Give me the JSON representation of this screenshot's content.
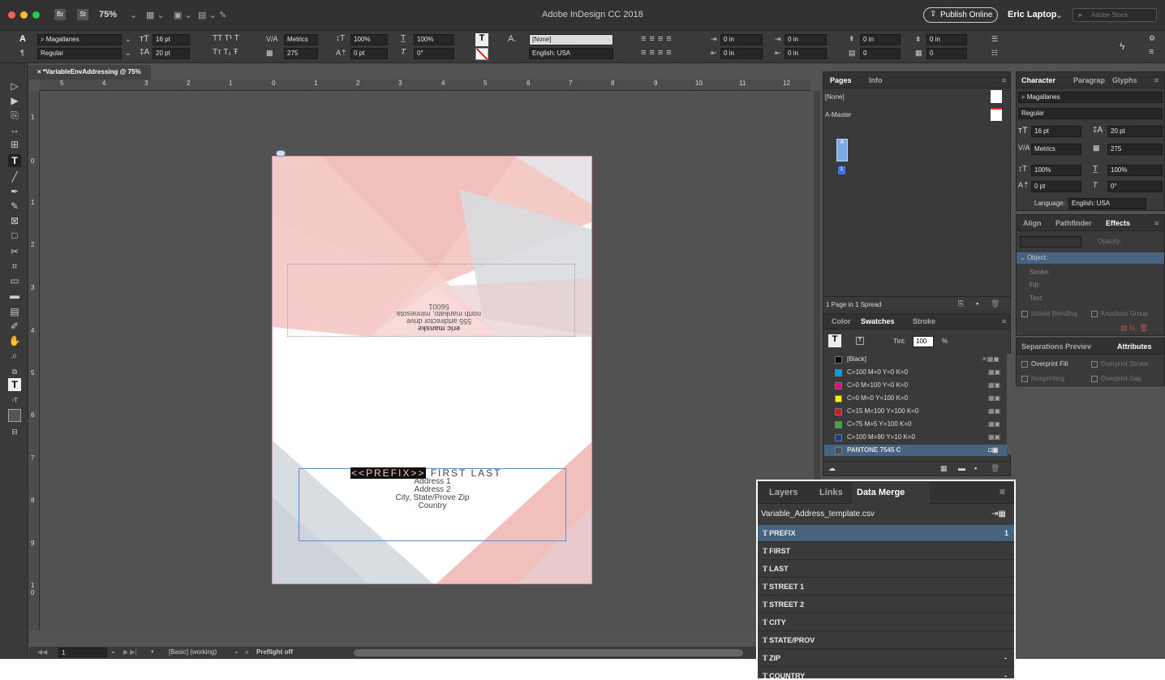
{
  "app": {
    "title": "Adobe InDesign CC 2018",
    "zoom": "75%",
    "br": "Br",
    "st": "St",
    "publish": "Publish Online",
    "user": "Eric Laptop",
    "stock_placeholder": "Adobe Stock"
  },
  "control": {
    "font": "Magallanes",
    "style": "Regular",
    "size": "16 pt",
    "leading": "20 pt",
    "kerning": "Metrics",
    "tracking": "275",
    "vscale": "100%",
    "hscale": "100%",
    "baseline": "0 pt",
    "skew": "0°",
    "char_style": "[None]",
    "language": "English: USA",
    "indent": "0 in",
    "space": "0"
  },
  "document": {
    "tab": "*VariableEnvAddressing @ 75%",
    "ruler_ticks": [
      "5",
      "4",
      "3",
      "2",
      "1",
      "0",
      "1",
      "2",
      "3",
      "4",
      "5",
      "6",
      "7",
      "8",
      "9",
      "10",
      "11",
      "12"
    ],
    "vruler_ticks": [
      "1",
      "0",
      "1",
      "2",
      "3",
      "4",
      "5",
      "6",
      "7",
      "8",
      "9",
      "1 0"
    ]
  },
  "envelope": {
    "return": [
      "eric manske",
      "555 artdirector drive",
      "north mankato, minnesota",
      "56001"
    ],
    "prefix": "<<PREFIX>>",
    "name": "FIRST LAST",
    "address": [
      "Address 1",
      "Address 2",
      "City, State/Prove Zip",
      "Country"
    ]
  },
  "status": {
    "page": "1",
    "master": "[Basic] (working)",
    "preflight": "Preflight off"
  },
  "pages_panel": {
    "tabs": [
      "Pages",
      "Info"
    ],
    "none": "[None]",
    "master": "A-Master",
    "page_num": "1",
    "a": "A",
    "footer": "1 Page in 1 Spread"
  },
  "swatch_panel": {
    "tabs": [
      "Color",
      "Swatches",
      "Stroke"
    ],
    "tint_label": "Tint:",
    "tint": "100",
    "pct": "%",
    "t": "T",
    "swatches": [
      {
        "name": "[Black]",
        "color": "#000000"
      },
      {
        "name": "C=100 M=0 Y=0 K=0",
        "color": "#00a0e9"
      },
      {
        "name": "C=0 M=100 Y=0 K=0",
        "color": "#e4007f"
      },
      {
        "name": "C=0 M=0 Y=100 K=0",
        "color": "#fff100"
      },
      {
        "name": "C=15 M=100 Y=100 K=0",
        "color": "#d21a1f"
      },
      {
        "name": "C=75 M=5 Y=100 K=0",
        "color": "#3ea83b"
      },
      {
        "name": "C=100 M=90 Y=10 K=0",
        "color": "#1f3d90"
      },
      {
        "name": "PANTONE 7545 C",
        "color": "#424f5c"
      }
    ]
  },
  "char_panel": {
    "tabs": [
      "Character",
      "Paragrap",
      "Glyphs"
    ],
    "font": "Magallanes",
    "style": "Regular",
    "size": "16 pt",
    "leading": "20 pt",
    "kerning": "Metrics",
    "tracking": "275",
    "vscale": "100%",
    "hscale": "100%",
    "baseline": "0 pt",
    "skew": "0°",
    "language_label": "Language:",
    "language": "English: USA"
  },
  "effects_panel": {
    "tabs": [
      "Align",
      "Pathfinder",
      "Effects"
    ],
    "opacity": "Opacity:",
    "object": "Object:",
    "items": [
      "Stroke:",
      "Fill:",
      "Text:"
    ],
    "isolate": "Isolate Blending",
    "knockout": "Knockout Group"
  },
  "attr_panel": {
    "tabs": [
      "Separations Previev",
      "Attributes"
    ],
    "checks": [
      "Overprint Fill",
      "Overprint Stroke",
      "Nonprinting",
      "Overprint Gap"
    ]
  },
  "data_merge": {
    "tabs": [
      "Layers",
      "Links",
      "Data Merge"
    ],
    "file": "Variable_Address_template.csv",
    "fields": [
      "PREFIX",
      "FIRST",
      "LAST",
      "STREET 1",
      "STREET 2",
      "CITY",
      "STATE/PROV",
      "ZIP",
      "COUNTRY"
    ],
    "record": "1"
  }
}
